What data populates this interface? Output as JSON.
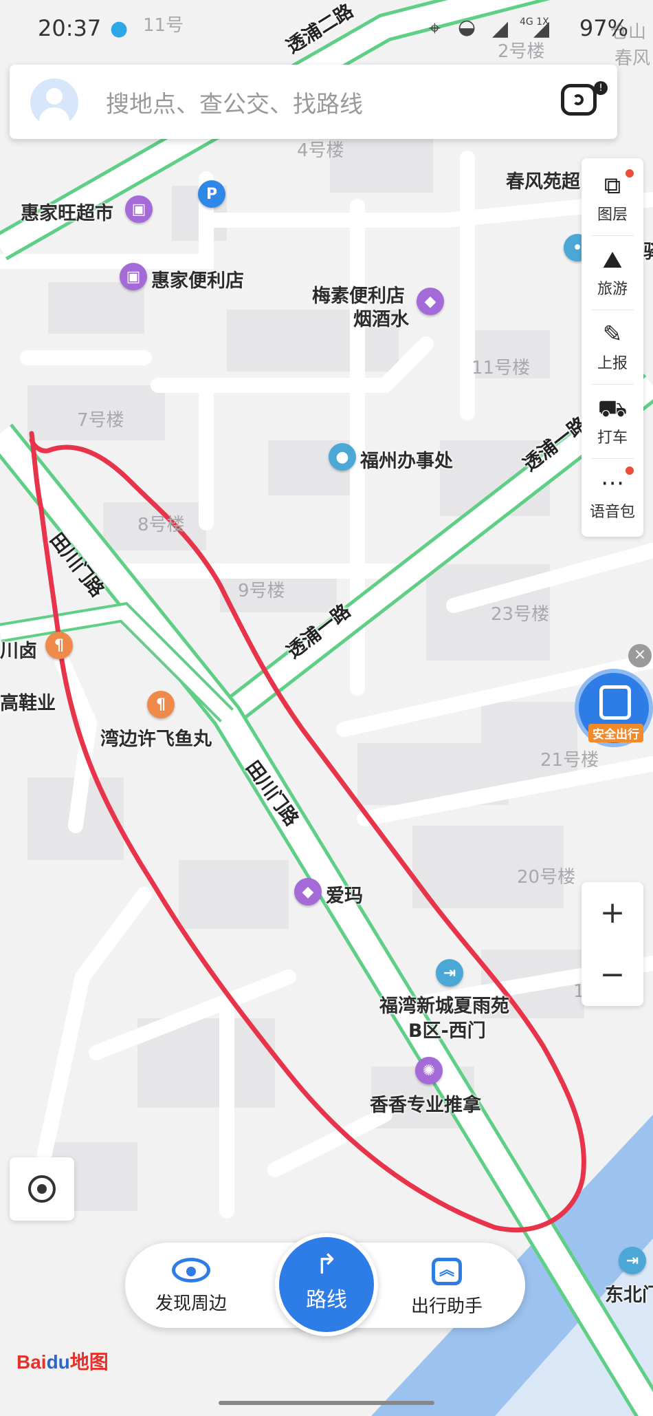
{
  "status_bar": {
    "time": "20:37",
    "network": "4G 1X",
    "battery": "97%"
  },
  "search": {
    "placeholder": "搜地点、查公交、找路线"
  },
  "tools": [
    {
      "label": "图层",
      "icon": "layers-icon"
    },
    {
      "label": "旅游",
      "icon": "travel-icon"
    },
    {
      "label": "上报",
      "icon": "report-icon"
    },
    {
      "label": "打车",
      "icon": "taxi-icon"
    },
    {
      "label": "语音包",
      "icon": "voice-pack-icon"
    }
  ],
  "safety": {
    "label": "安全出行",
    "close": "×"
  },
  "zoom": {
    "in": "+",
    "out": "−"
  },
  "bottom_nav": {
    "discover": "发现周边",
    "route": "路线",
    "assistant": "出行助手"
  },
  "logo": {
    "left": "Bai",
    "mid": "du",
    "right": "地图"
  },
  "map": {
    "roads": {
      "touyong2": "透浦二路",
      "touyong1": "透浦一路",
      "touyong1_b": "透浦一路",
      "wanbian_top": "田川门路",
      "wanbian_mid": "田川门路"
    },
    "buildings": {
      "b11_top": "11号",
      "b2": "2号楼",
      "b4": "4号楼",
      "b11": "11号楼",
      "b7": "7号楼",
      "b8": "8号楼",
      "b9": "9号楼",
      "b23": "23号楼",
      "b21": "21号楼",
      "b20": "20号楼",
      "b1": "1",
      "chunfeng_top": "春风",
      "cang": "仓山"
    },
    "pois": {
      "huijia_super": "惠家旺超市",
      "huijia_conv": "惠家便利店",
      "meisu_1": "梅素便利店",
      "meisu_2": "烟酒水",
      "fuzhou_office": "福州办事处",
      "chunfeng": "春风苑超",
      "chuanlu": "川卤",
      "gaoxie": "高鞋业",
      "fish_ball": "湾边许飞鱼丸",
      "aima": "爱玛",
      "fuwan_1": "福湾新城夏雨苑",
      "fuwan_2": "B区-西门",
      "massage": "香香专业推拿",
      "dongbei": "东北门",
      "yi": "驿"
    }
  }
}
